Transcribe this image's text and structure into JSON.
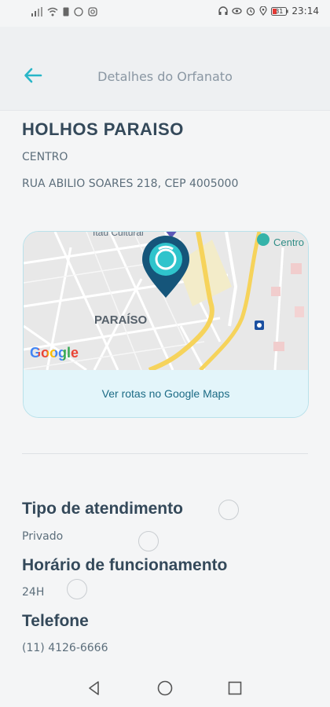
{
  "status_bar": {
    "left_icons": [
      "signal-icon",
      "wifi-icon",
      "sim-icon",
      "whatsapp-icon",
      "instagram-icon"
    ],
    "right_icons": [
      "headset-icon",
      "eye-icon",
      "alarm-icon",
      "location-icon",
      "battery-icon"
    ],
    "battery": "31",
    "time": "23:14"
  },
  "header": {
    "title": "Detalhes do Orfanato",
    "back_icon": "arrow-left-icon",
    "accent": "#29b6c8"
  },
  "orphanage": {
    "name": "HOLHOS PARAISO",
    "district": "CENTRO",
    "address": "RUA ABILIO SOARES 218, CEP 4005000"
  },
  "map": {
    "place_label": "PARAÍSO",
    "poi_top": "Itaú Cultural",
    "poi_right": "Centro",
    "logo": "Google",
    "link_label": "Ver rotas no Google Maps",
    "pin_color": "#15557a",
    "pin_inner": "#2fc4cc"
  },
  "details": {
    "service_type_label": "Tipo de atendimento",
    "service_type_value": "Privado",
    "hours_label": "Horário de funcionamento",
    "hours_value": "24H",
    "phone_label": "Telefone",
    "phone_value": "(11) 4126-6666"
  },
  "nav_bar": {
    "back": "triangle-back-icon",
    "home": "circle-home-icon",
    "recents": "square-recents-icon"
  }
}
